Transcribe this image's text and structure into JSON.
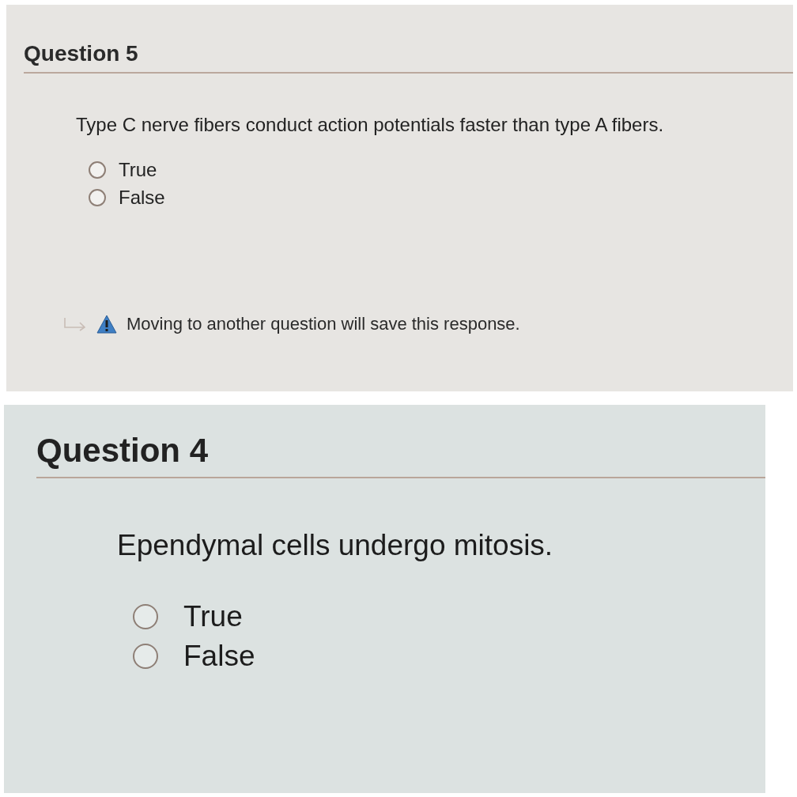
{
  "questions": [
    {
      "title": "Question 5",
      "prompt": "Type C nerve fibers conduct action potentials faster than type A fibers.",
      "options": [
        {
          "label": "True",
          "selected": false
        },
        {
          "label": "False",
          "selected": false
        }
      ],
      "notice": "Moving to another question will save this response."
    },
    {
      "title": "Question 4",
      "prompt": "Ependymal cells undergo mitosis.",
      "options": [
        {
          "label": "True",
          "selected": false
        },
        {
          "label": "False",
          "selected": false
        }
      ]
    }
  ]
}
